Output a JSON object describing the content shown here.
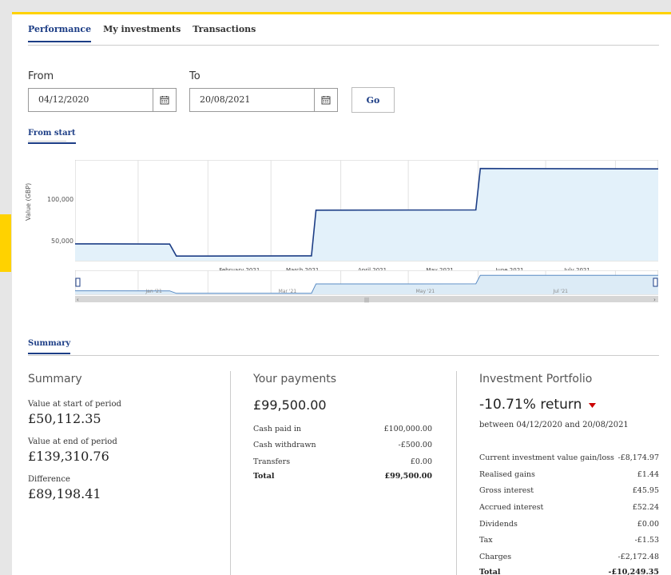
{
  "tabs": [
    {
      "label": "Performance",
      "active": true
    },
    {
      "label": "My investments",
      "active": false
    },
    {
      "label": "Transactions",
      "active": false
    }
  ],
  "date_range": {
    "from_label": "From",
    "from_value": "04/12/2020",
    "to_label": "To",
    "to_value": "20/08/2021",
    "go_label": "Go"
  },
  "chart_tab": "From start",
  "chart_data": {
    "type": "line",
    "ylabel": "Value (GBP)",
    "yticks": [
      50000,
      100000
    ],
    "ytick_labels": [
      "50,000",
      "100,000"
    ],
    "ylim": [
      30000,
      150000
    ],
    "xticks": [
      "February 2021",
      "March 2021",
      "April 2021",
      "May 2021",
      "June 2021",
      "July 2021"
    ],
    "navigator_ticks": [
      "Jan '21",
      "Mar '21",
      "May '21",
      "Jul '21"
    ],
    "series": [
      {
        "points": [
          [
            "2020-12-04",
            50112
          ],
          [
            "2021-01-15",
            49800
          ],
          [
            "2021-01-18",
            35500
          ],
          [
            "2021-03-19",
            35800
          ],
          [
            "2021-03-21",
            90200
          ],
          [
            "2021-05-31",
            90500
          ],
          [
            "2021-06-02",
            139800
          ],
          [
            "2021-08-20",
            139311
          ]
        ]
      }
    ],
    "colors": {
      "line": "#1d3e86",
      "fill": "#e3f1fa"
    }
  },
  "summary_tab": "Summary",
  "summary": {
    "title": "Summary",
    "start_label": "Value at start of period",
    "start_value": "£50,112.35",
    "end_label": "Value at end of period",
    "end_value": "£139,310.76",
    "diff_label": "Difference",
    "diff_value": "£89,198.41"
  },
  "payments": {
    "title": "Your payments",
    "total_big": "£99,500.00",
    "rows": [
      {
        "label": "Cash paid in",
        "value": "£100,000.00"
      },
      {
        "label": "Cash withdrawn",
        "value": "-£500.00"
      },
      {
        "label": "Transfers",
        "value": "£0.00"
      },
      {
        "label": "Total",
        "value": "£99,500.00"
      }
    ]
  },
  "portfolio": {
    "title": "Investment Portfolio",
    "return_value": "-10.71% return",
    "period": "between 04/12/2020 and 20/08/2021",
    "rows": [
      {
        "label": "Current investment value gain/loss",
        "value": "-£8,174.97"
      },
      {
        "label": "Realised gains",
        "value": "£1.44"
      },
      {
        "label": "Gross interest",
        "value": "£45.95"
      },
      {
        "label": "Accrued interest",
        "value": "£52.24"
      },
      {
        "label": "Dividends",
        "value": "£0.00"
      },
      {
        "label": "Tax",
        "value": "-£1.53"
      },
      {
        "label": "Charges",
        "value": "-£2,172.48"
      },
      {
        "label": "Total",
        "value": "-£10,249.35"
      }
    ]
  },
  "colors": {
    "accent": "#ffd200",
    "brand": "#1d3e86",
    "negative": "#cc0000"
  }
}
